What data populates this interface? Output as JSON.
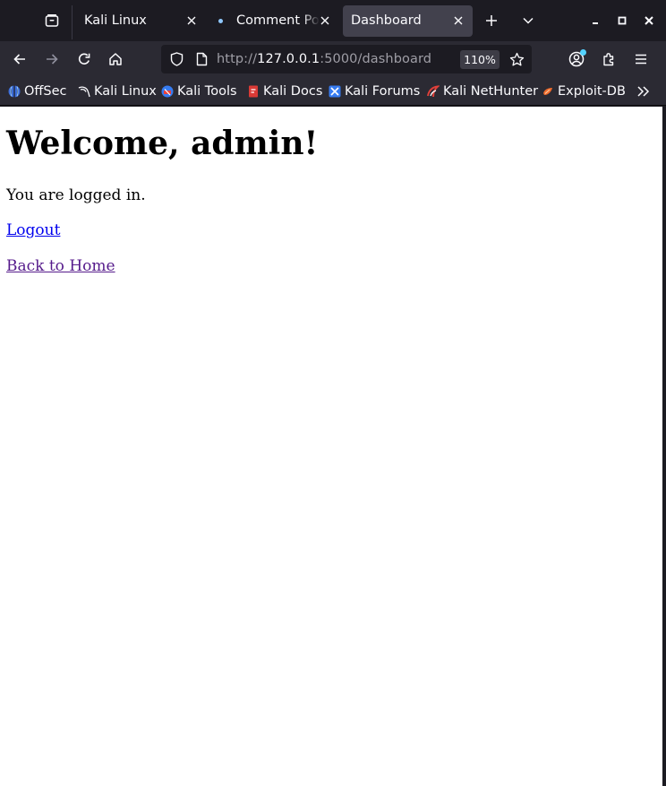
{
  "tabs": [
    {
      "title": "Kali Linux",
      "active": false
    },
    {
      "title": "Comment Posted",
      "active": false
    },
    {
      "title": "Dashboard",
      "active": true
    }
  ],
  "toolbar": {
    "url_scheme": "http://",
    "url_host": "127.0.0.1",
    "url_rest": ":5000/dashboard",
    "zoom": "110%"
  },
  "bookmarks": [
    {
      "label": "OffSec",
      "icon": "offsec-icon"
    },
    {
      "label": "Kali Linux",
      "icon": "kali-dragon-icon"
    },
    {
      "label": "Kali Tools",
      "icon": "kali-tools-icon"
    },
    {
      "label": "Kali Docs",
      "icon": "kali-docs-icon"
    },
    {
      "label": "Kali Forums",
      "icon": "kali-forums-icon"
    },
    {
      "label": "Kali NetHunter",
      "icon": "nethunter-icon"
    },
    {
      "label": "Exploit-DB",
      "icon": "exploit-db-icon"
    }
  ],
  "page": {
    "heading": "Welcome, admin!",
    "status": "You are logged in.",
    "logout_link": "Logout",
    "home_link": "Back to Home"
  },
  "colors": {
    "tab_strip": "#1c1b22",
    "toolbar": "#2b2a33",
    "active_tab": "#42414d",
    "link": "#0000ee",
    "visited_link": "#551a8b"
  }
}
